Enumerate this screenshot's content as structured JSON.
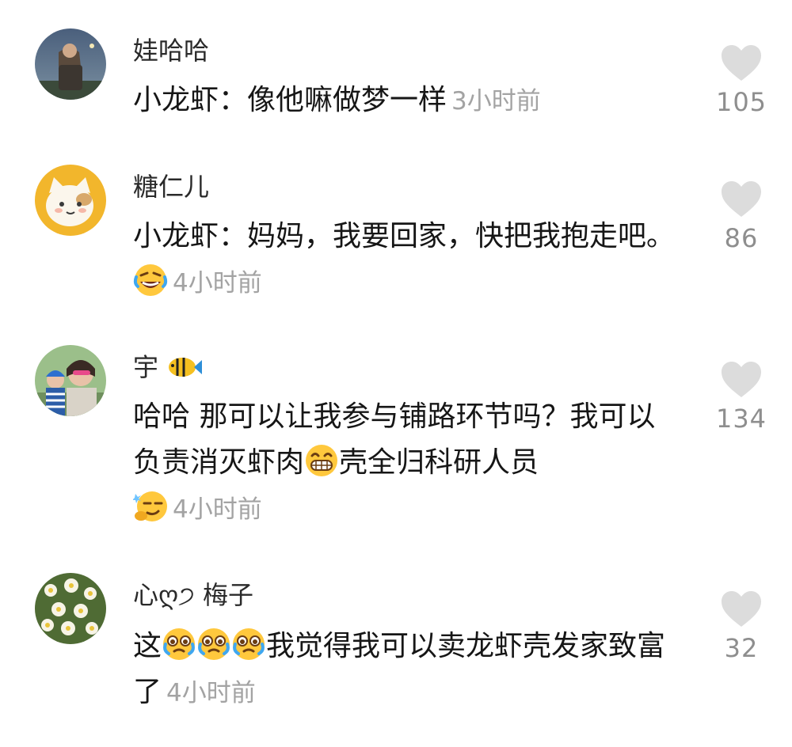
{
  "comments": [
    {
      "username": "娃哈哈",
      "text": "小龙虾：像他嘛做梦一样",
      "time": "3小时前",
      "likes": "105",
      "avatar": "avatar-man-at-night"
    },
    {
      "username": "糖仁儿",
      "text": "小龙虾：妈妈，我要回家，快把我抱走吧。",
      "emoji": "rolling-laugh-emoji",
      "time": "4小时前",
      "likes": "86",
      "avatar": "avatar-cartoon-cat"
    },
    {
      "username": "宇",
      "name_emoji": "tropical-fish-emoji",
      "text_a": "哈哈 那可以让我参与铺路环节吗？我可以负责消灭虾肉",
      "emoji_mid": "grin-emoji",
      "text_b": "壳全归科研人员",
      "emoji_end": "smirk-emoji",
      "time": "4小时前",
      "likes": "134",
      "avatar": "avatar-mother-and-child"
    },
    {
      "username": "心ღ੭ 梅子",
      "text_a": "这",
      "emojis": [
        "teary-eyed-emoji",
        "teary-eyed-emoji",
        "teary-eyed-emoji"
      ],
      "text_b": "我觉得我可以卖龙虾壳发家致富了",
      "time": "4小时前",
      "likes": "32",
      "avatar": "avatar-white-flowers"
    }
  ],
  "colors": {
    "like_heart": "#dcdcdc",
    "like_count": "#8e8e8e",
    "time": "#a3a3a3",
    "username": "#2a2a2a"
  }
}
